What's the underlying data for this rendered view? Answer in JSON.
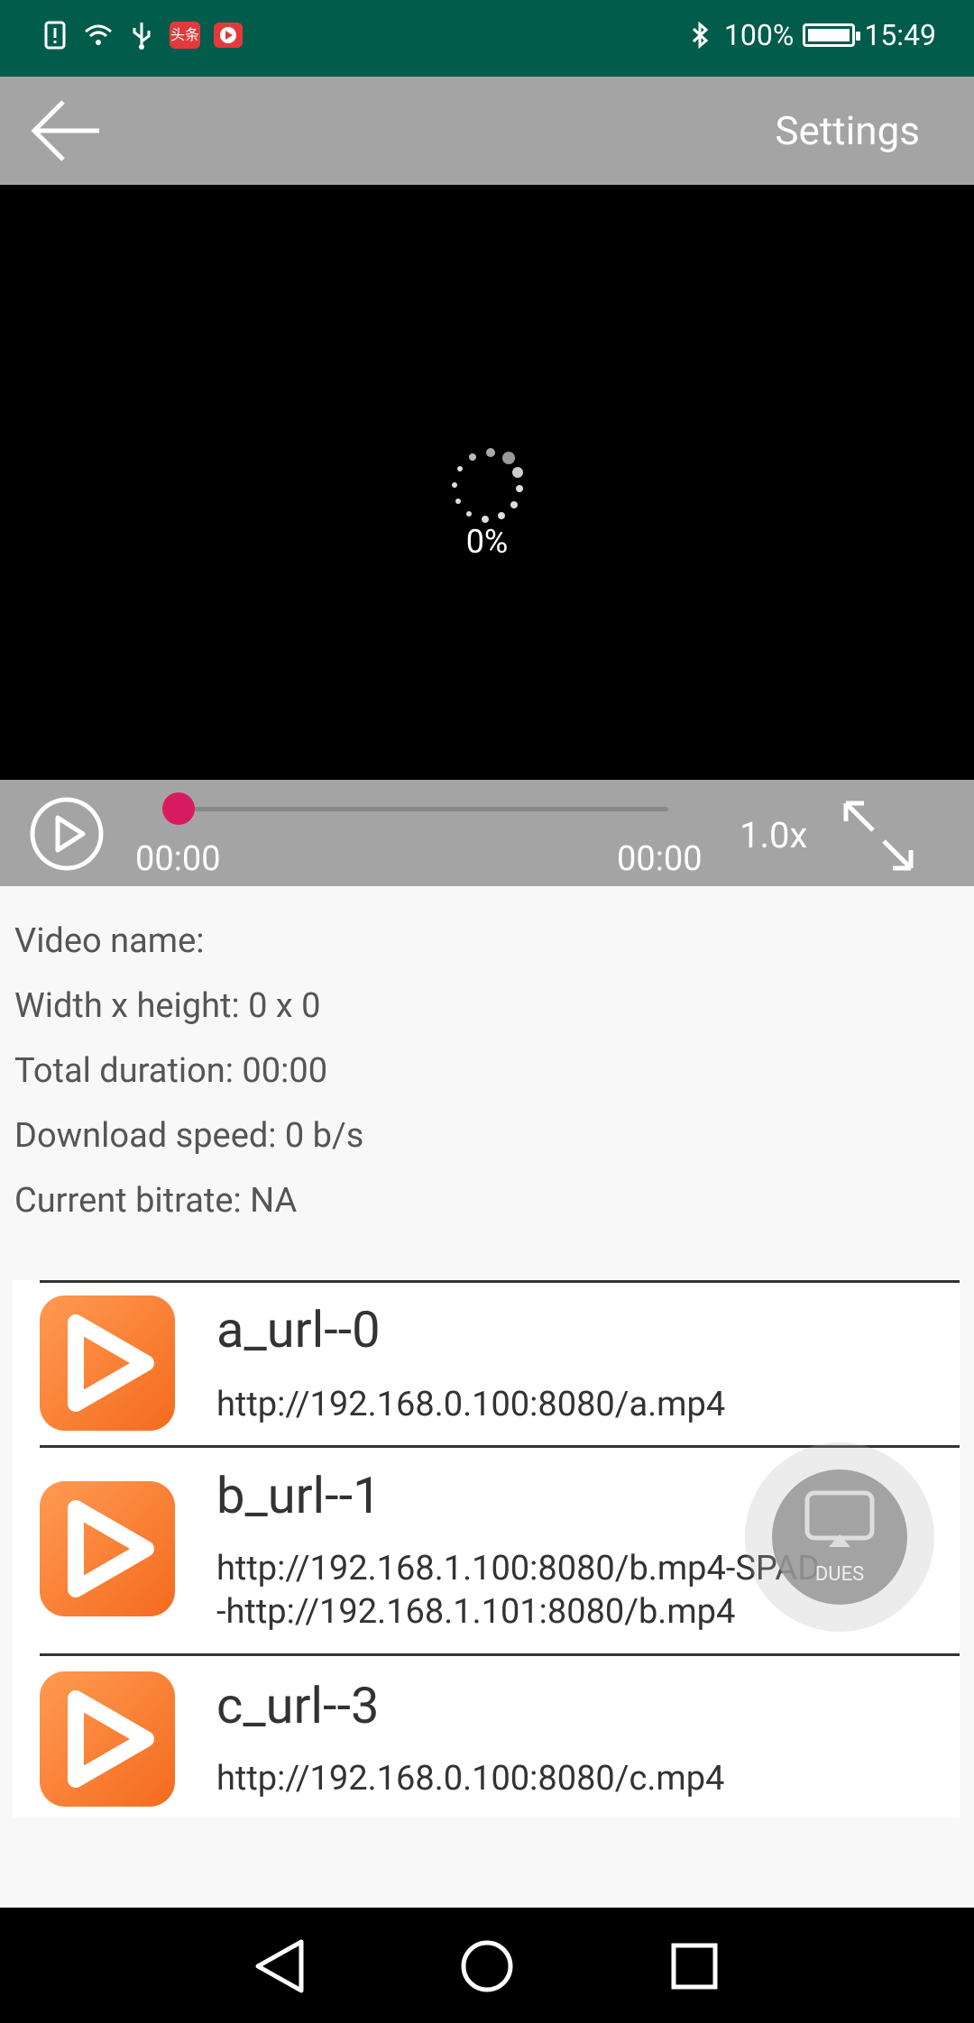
{
  "status_bar": {
    "battery": "100%",
    "time": "15:49",
    "badge_text": "头条"
  },
  "toolbar": {
    "settings_label": "Settings"
  },
  "video": {
    "loading_progress": "0%"
  },
  "controls": {
    "current_time": "00:00",
    "total_time": "00:00",
    "speed": "1.0x",
    "seek_fraction": 0.0
  },
  "info": {
    "video_name": "Video name:",
    "dimensions": "Width x height: 0 x 0",
    "duration": "Total duration: 00:00",
    "download_speed": "Download speed: 0 b/s",
    "bitrate": "Current bitrate: NA"
  },
  "list": [
    {
      "title": "a_url--0",
      "url": "http://192.168.0.100:8080/a.mp4"
    },
    {
      "title": "b_url--1",
      "url": "http://192.168.1.100:8080/b.mp4-SPAD\n-http://192.168.1.101:8080/b.mp4"
    },
    {
      "title": "c_url--3",
      "url": "http://192.168.0.100:8080/c.mp4"
    }
  ],
  "fab": {
    "label": "DUES"
  }
}
